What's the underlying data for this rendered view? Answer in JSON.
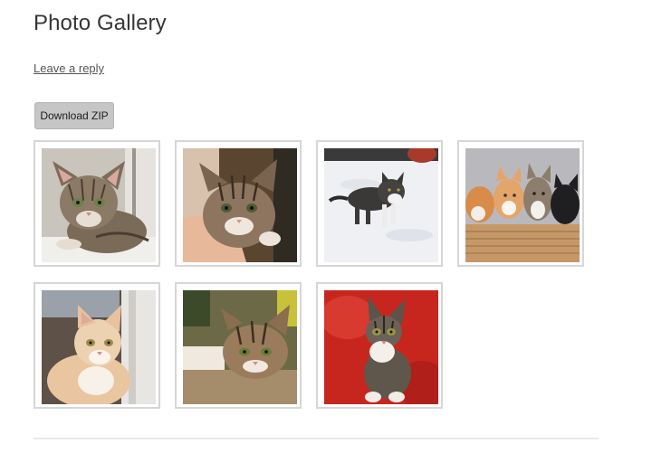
{
  "page": {
    "title": "Photo Gallery",
    "reply_link": "Leave a reply",
    "download_label": "Download ZIP"
  },
  "gallery": {
    "images": [
      {
        "subject": "tabby kitten lying on a windowsill"
      },
      {
        "subject": "tabby kitten held in a hand"
      },
      {
        "subject": "black and white kitten walking in snow"
      },
      {
        "subject": "group of kittens in a wicker basket"
      },
      {
        "subject": "ginger and white cat by a door"
      },
      {
        "subject": "tabby kitten peeking over a ledge"
      },
      {
        "subject": "tabby kitten sitting on a red chair"
      }
    ]
  },
  "colors": {
    "thumb_border": "#d6d6d6",
    "button_bg": "#c6c6c6",
    "title_text": "#363636",
    "link_text": "#555555"
  }
}
